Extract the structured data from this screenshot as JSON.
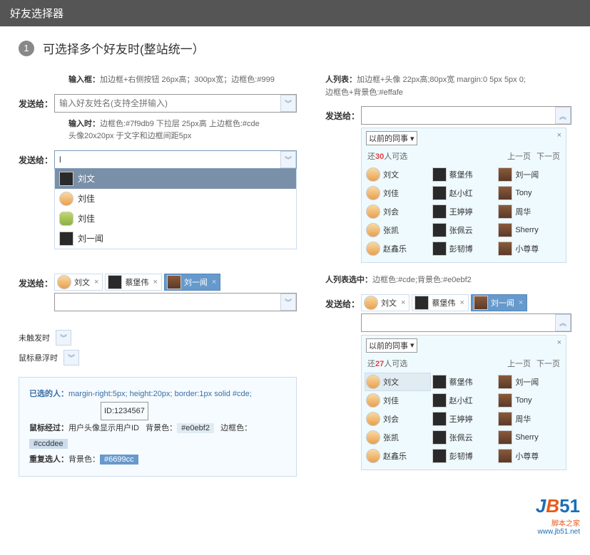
{
  "header": "好友选择器",
  "section": {
    "num": "1",
    "title": "可选择多个好友时(整站统一）"
  },
  "spec_input": {
    "lbl": "输入框：",
    "txt": "加边框+右侧按钮 26px高；300px宽；边框色:#999"
  },
  "spec_list": {
    "lbl": "人列表：",
    "txt1": "加边框+头像 22px高;80px宽 margin:0 5px 5px 0;",
    "txt2": "边框色+背景色:#effafe"
  },
  "spec_typing": {
    "lbl": "输入时：",
    "txt1": "边框色:#7f9db9 下拉层 25px高 上边框色:#cde",
    "txt2": "头像20x20px 于文字和边框间距5px"
  },
  "spec_listsel": {
    "lbl": "人列表选中：",
    "txt": "边框色:#cde;背景色:#e0ebf2"
  },
  "send_to": "发送给：",
  "placeholder": "输入好友姓名(支持全拼输入)",
  "typed_val": "l",
  "dropdown": [
    {
      "name": "刘文",
      "av": "av-dark",
      "sel": true
    },
    {
      "name": "刘佳",
      "av": "av-monkey"
    },
    {
      "name": "刘佳",
      "av": "av-girl"
    },
    {
      "name": "刘一闻",
      "av": "av-dark"
    }
  ],
  "chips": [
    {
      "name": "刘文",
      "av": "av-monkey"
    },
    {
      "name": "蔡堡伟",
      "av": "av-dark"
    },
    {
      "name": "刘一闻",
      "av": "av-photo",
      "sel": true
    }
  ],
  "chips_r": [
    {
      "name": "刘文",
      "av": "av-monkey"
    },
    {
      "name": "蔡堡伟",
      "av": "av-dark"
    },
    {
      "name": "刘一闻",
      "av": "av-photo",
      "sel": true
    }
  ],
  "mini_untrigger": "未触发时",
  "mini_hover": "鼠标悬浮时",
  "panel_hd": "以前的同事",
  "panel1": {
    "count": "30",
    "prefix": "还",
    "suffix": "人可选"
  },
  "panel2": {
    "count": "27",
    "prefix": "还",
    "suffix": "人可选"
  },
  "prev": "上一页",
  "next": "下一页",
  "friends": [
    {
      "name": "刘文",
      "av": "av-monkey"
    },
    {
      "name": "蔡堡伟",
      "av": "av-dark"
    },
    {
      "name": "刘一闻",
      "av": "av-photo"
    },
    {
      "name": "刘佳",
      "av": "av-monkey"
    },
    {
      "name": "赵小红",
      "av": "av-dark"
    },
    {
      "name": "Tony",
      "av": "av-photo"
    },
    {
      "name": "刘会",
      "av": "av-monkey"
    },
    {
      "name": "王婷婷",
      "av": "av-dark"
    },
    {
      "name": "周华",
      "av": "av-photo"
    },
    {
      "name": "张凯",
      "av": "av-monkey"
    },
    {
      "name": "张佩云",
      "av": "av-dark"
    },
    {
      "name": "Sherry",
      "av": "av-photo"
    },
    {
      "name": "赵鑫乐",
      "av": "av-monkey"
    },
    {
      "name": "彭韧博",
      "av": "av-dark"
    },
    {
      "name": "小尊尊",
      "av": "av-photo"
    }
  ],
  "selbox": {
    "title": "已选的人：",
    "spec1": "margin-right:5px; height:20px; border:1px solid #cde;",
    "id_lbl": "ID:1234567",
    "hover_lbl": "鼠标经过：",
    "hover_txt": "用户头像显示用户ID",
    "bg_lbl": "背景色：",
    "bg_val": "#e0ebf2",
    "bd_lbl": "边框色：",
    "bd_val": "#ccddee",
    "dup_lbl": "重复选人：",
    "dup_bg": "背景色：",
    "dup_val": "#6699cc"
  },
  "logo": {
    "tag": "脚本之家",
    "url": "www.jb51.net"
  }
}
